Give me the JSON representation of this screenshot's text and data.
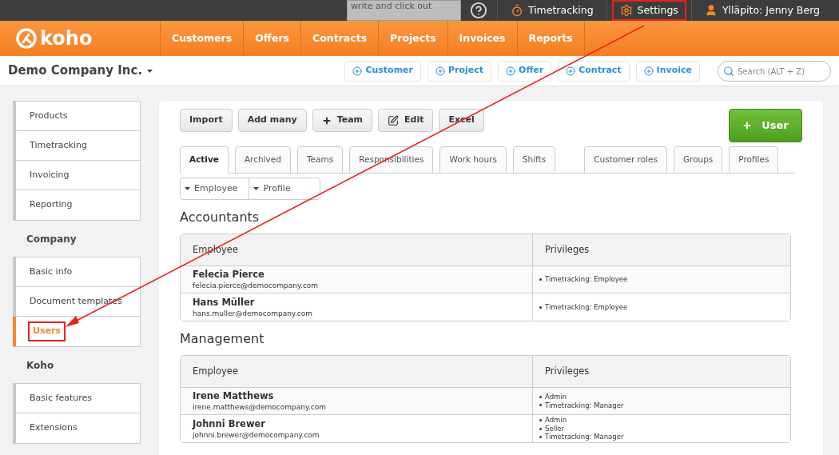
{
  "topbar": {
    "note_placeholder": "write and click out",
    "links": [
      {
        "kind": "timer",
        "label": "Timetracking",
        "highlighted": false
      },
      {
        "kind": "gear",
        "label": "Settings",
        "highlighted": true
      },
      {
        "kind": "user",
        "label": "Ylläpito: Jenny Berg",
        "highlighted": false
      }
    ]
  },
  "logo": "koho",
  "nav": [
    "Customers",
    "Offers",
    "Contracts",
    "Projects",
    "Invoices",
    "Reports"
  ],
  "company": "Demo Company Inc.",
  "quick_add": [
    "Customer",
    "Project",
    "Offer",
    "Contract",
    "Invoice"
  ],
  "search": {
    "placeholder": "Search (ALT + Z)"
  },
  "sidebar": [
    {
      "items": [
        {
          "label": "Products",
          "selected": false,
          "highlighted": false
        },
        {
          "label": "Timetracking",
          "selected": false,
          "highlighted": false
        },
        {
          "label": "Invoicing",
          "selected": false,
          "highlighted": false
        },
        {
          "label": "Reporting",
          "selected": false,
          "highlighted": false
        }
      ]
    },
    {
      "heading": "Company",
      "items": [
        {
          "label": "Basic info",
          "selected": false,
          "highlighted": false
        },
        {
          "label": "Document templates",
          "selected": false,
          "highlighted": false
        },
        {
          "label": "Users",
          "selected": true,
          "highlighted": true
        }
      ]
    },
    {
      "heading": "Koho",
      "items": [
        {
          "label": "Basic features",
          "selected": false,
          "highlighted": false
        },
        {
          "label": "Extensions",
          "selected": false,
          "highlighted": false
        }
      ]
    }
  ],
  "toolbar": [
    {
      "kind": "plain",
      "label": "Import"
    },
    {
      "kind": "plain",
      "label": "Add many"
    },
    {
      "kind": "plus",
      "label": "Team"
    },
    {
      "kind": "edit",
      "label": "Edit"
    },
    {
      "kind": "plain",
      "label": "Excel"
    }
  ],
  "add_user_button": "User",
  "tabs": [
    {
      "label": "Active",
      "selected": true
    },
    {
      "label": "Archived",
      "selected": false
    },
    {
      "label": "Teams",
      "selected": false
    },
    {
      "label": "Responsibilities",
      "selected": false
    },
    {
      "label": "Work hours",
      "selected": false
    },
    {
      "label": "Shifts",
      "selected": false
    }
  ],
  "role_tabs": [
    {
      "label": "Customer roles",
      "selected": false
    },
    {
      "label": "Groups",
      "selected": false
    },
    {
      "label": "Profiles",
      "selected": false
    }
  ],
  "filters": [
    "Employee",
    "Profile"
  ],
  "groups": [
    {
      "title": "Accountants",
      "columns": [
        "Employee",
        "Privileges"
      ],
      "rows": [
        {
          "name": "Felecia Pierce",
          "email": "felecia.pierce@democompany.com",
          "privileges": [
            "Timetracking: Employee"
          ]
        },
        {
          "name": "Hans Müller",
          "email": "hans.muller@democompany.com",
          "privileges": [
            "Timetracking: Employee"
          ]
        }
      ]
    },
    {
      "title": "Management",
      "columns": [
        "Employee",
        "Privileges"
      ],
      "rows": [
        {
          "name": "Irene Matthews",
          "email": "irene.matthews@democompany.com",
          "privileges": [
            "Admin",
            "Timetracking: Manager"
          ]
        },
        {
          "name": "Johnni Brewer",
          "email": "johnni.brewer@democompany.com",
          "privileges": [
            "Admin",
            "Seller",
            "Timetracking: Manager"
          ]
        }
      ]
    }
  ]
}
